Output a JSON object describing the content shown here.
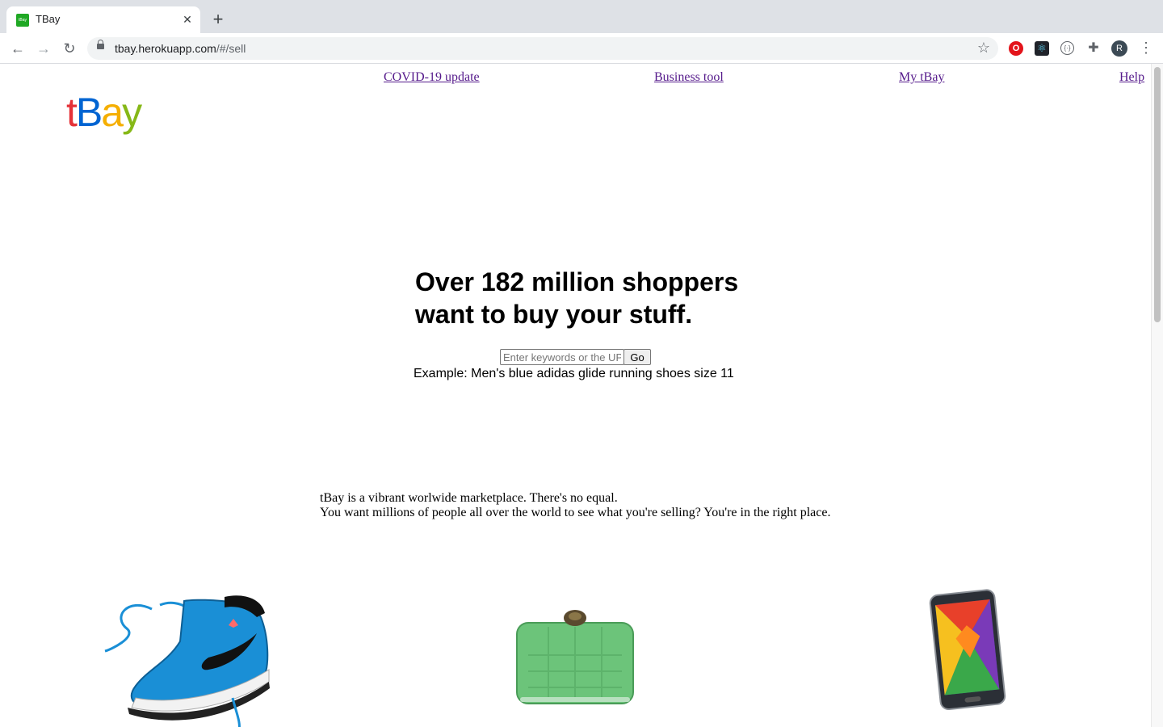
{
  "browser": {
    "tab_title": "TBay",
    "favicon_text": "tBay",
    "url_host": "tbay.herokuapp.com",
    "url_path": "/#/sell",
    "avatar_initial": "R"
  },
  "nav": {
    "links": [
      {
        "label": "COVID-19 update"
      },
      {
        "label": "Business tool"
      },
      {
        "label": "My tBay"
      },
      {
        "label": "Help"
      }
    ]
  },
  "logo": {
    "letters": [
      {
        "char": "t",
        "color": "#e53238"
      },
      {
        "char": "B",
        "color": "#0064d2"
      },
      {
        "char": "a",
        "color": "#f5af02"
      },
      {
        "char": "y",
        "color": "#86b817"
      }
    ]
  },
  "hero": {
    "line1": "Over 182 million shoppers",
    "line2": "want to buy your stuff."
  },
  "search": {
    "placeholder": "Enter keywords or the UPC",
    "value": "",
    "button_label": "Go",
    "example": "Example: Men's blue adidas glide running shoes size 11"
  },
  "blurb": {
    "line1": "tBay is a vibrant worlwide marketplace. There's no equal.",
    "line2": "You want millions of people all over the world to see what you're selling? You're in the right place."
  },
  "products": [
    {
      "name": "blue-sneaker-image"
    },
    {
      "name": "green-clutch-image"
    },
    {
      "name": "smartphone-image"
    }
  ],
  "colors": {
    "link": "#551a8b",
    "sneaker_blue": "#1a8fd6",
    "clutch_green": "#6cc47a"
  }
}
